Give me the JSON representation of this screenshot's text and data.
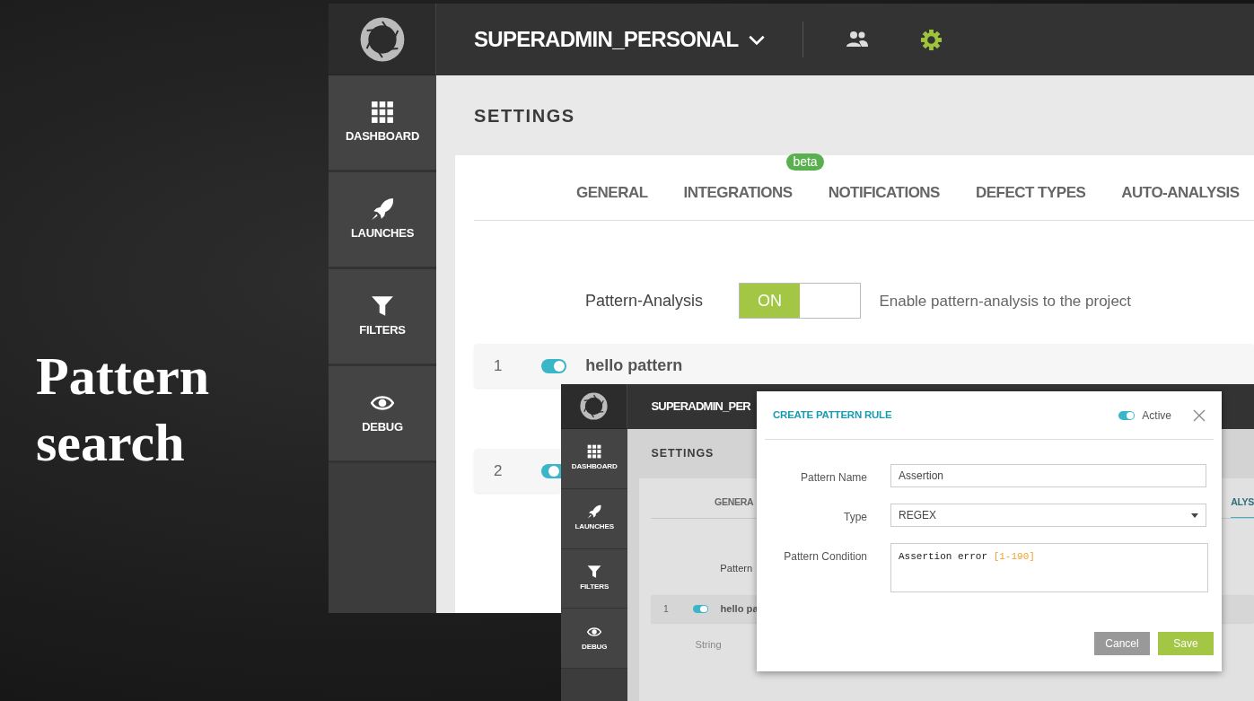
{
  "slide_title": "Pattern search",
  "back_screenshot": {
    "project": "SUPERADMIN_PERSONAL",
    "header_icons": [
      {
        "kind": "members",
        "selected": false
      },
      {
        "kind": "settings",
        "selected": true
      }
    ],
    "sidebar": [
      {
        "kind": "dashboard",
        "label": "DASHBOARD"
      },
      {
        "kind": "launches",
        "label": "LAUNCHES"
      },
      {
        "kind": "filters",
        "label": "FILTERS"
      },
      {
        "kind": "debug",
        "label": "DEBUG"
      }
    ],
    "page_title": "SETTINGS",
    "tabs": [
      {
        "label": "GENERAL",
        "selected": false
      },
      {
        "label": "INTEGRATIONS",
        "badge": "beta",
        "selected": false
      },
      {
        "label": "NOTIFICATIONS",
        "selected": false
      },
      {
        "label": "DEFECT TYPES",
        "selected": false
      },
      {
        "label": "AUTO-ANALYSIS",
        "selected": false
      }
    ],
    "pattern_analysis": {
      "label": "Pattern-Analysis",
      "on": true,
      "state_label": "ON",
      "description": "Enable pattern-analysis to the project"
    },
    "patterns": [
      {
        "number": "1",
        "active": true,
        "name": "hello pattern"
      },
      {
        "number": "2",
        "active": true
      }
    ]
  },
  "front_screenshot": {
    "project": "SUPERADMIN_PER",
    "sidebar": [
      {
        "kind": "dashboard",
        "label": "DASHBOARD"
      },
      {
        "kind": "launches",
        "label": "LAUNCHES"
      },
      {
        "kind": "filters",
        "label": "FILTERS"
      },
      {
        "kind": "debug",
        "label": "DEBUG"
      }
    ],
    "page_title": "SETTINGS",
    "tabs": [
      {
        "label": "GENERA",
        "selected": false
      },
      {
        "label": "ALYS",
        "selected": true
      }
    ],
    "pattern_analysis": {
      "label": "Pattern"
    },
    "patterns": [
      {
        "number": "1",
        "active": true,
        "name": "hello pa",
        "detail": "String"
      }
    ],
    "dialog": {
      "title": "CREATE PATTERN RULE",
      "active": true,
      "active_label": "Active",
      "fields": [
        {
          "kind": "text",
          "label": "Pattern Name",
          "value": "Assertion"
        },
        {
          "kind": "select",
          "label": "Type",
          "value": "REGEX"
        },
        {
          "kind": "code",
          "label": "Pattern Condition",
          "parts": [
            {
              "kind": "plain",
              "text": "Assertion error"
            },
            {
              "kind": "range",
              "text": "[1-190]"
            }
          ]
        }
      ],
      "buttons": [
        {
          "kind": "cancel",
          "label": "Cancel"
        },
        {
          "kind": "save",
          "label": "Save"
        }
      ]
    }
  }
}
